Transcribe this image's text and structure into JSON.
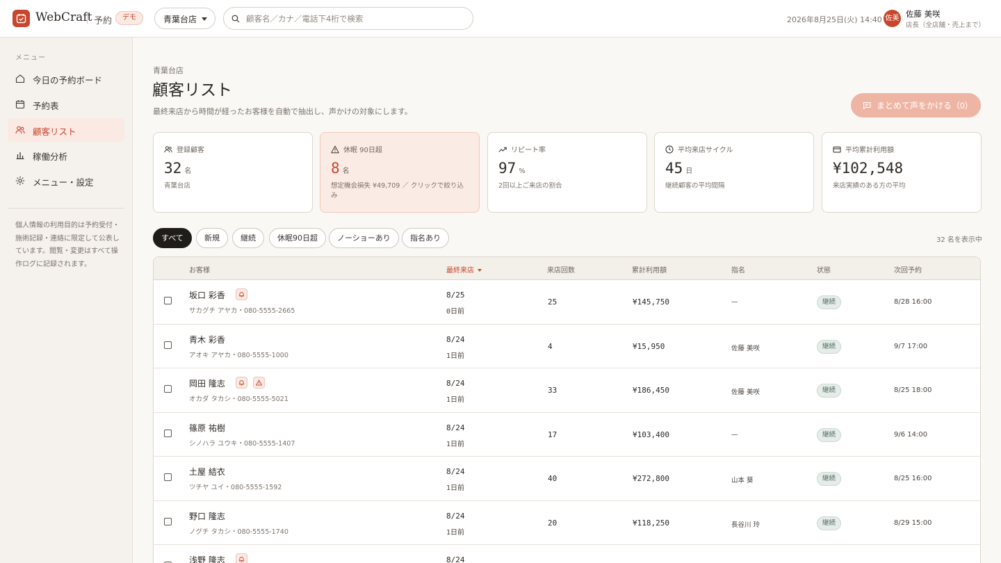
{
  "header": {
    "brand": "WebCraft",
    "brand_sub": "予約",
    "demo_badge": "デモ",
    "store": "青葉台店",
    "search_placeholder": "顧客名／カナ／電話下4桁で検索",
    "datetime": "2026年8月25日(火) 14:40",
    "user_initials": "佐美",
    "user_name": "佐藤 美咲",
    "user_role": "店長（全店舗・売上まで）"
  },
  "sidebar": {
    "heading": "メニュー",
    "items": [
      {
        "label": "今日の予約ボード",
        "icon": "home-icon"
      },
      {
        "label": "予約表",
        "icon": "calendar-icon"
      },
      {
        "label": "顧客リスト",
        "icon": "users-icon",
        "active": true
      },
      {
        "label": "稼働分析",
        "icon": "bar-chart-icon"
      },
      {
        "label": "メニュー・設定",
        "icon": "gear-icon"
      }
    ],
    "note": "個人情報の利用目的は予約受付・施術記録・連絡に限定して公表しています。閲覧・変更はすべて操作ログに記録されます。"
  },
  "main": {
    "breadcrumb": "青葉台店",
    "title": "顧客リスト",
    "description": "最終来店から時間が経ったお客様を自動で抽出し、声かけの対象にします。",
    "bulk_button": "まとめて声をかける（0）",
    "cards": [
      {
        "label": "登録顧客",
        "value": "32",
        "unit": "名",
        "sub": "青葉台店",
        "icon": "users-icon"
      },
      {
        "label": "休眠 90日超",
        "value": "8",
        "unit": "名",
        "sub": "想定機会損失 ¥49,709 ／ クリックで絞り込み",
        "icon": "warning-icon",
        "alert": true
      },
      {
        "label": "リピート率",
        "value": "97",
        "unit": "%",
        "sub": "2回以上ご来店の割合",
        "icon": "trend-up-icon"
      },
      {
        "label": "平均来店サイクル",
        "value": "45",
        "unit": "日",
        "sub": "継続顧客の平均間隔",
        "icon": "clock-icon"
      },
      {
        "label": "平均累計利用額",
        "value": "¥102,548",
        "unit": "",
        "sub": "来店実績のある方の平均",
        "icon": "wallet-icon"
      }
    ],
    "filters": [
      "すべて",
      "新規",
      "継続",
      "休眠90日超",
      "ノーショーあり",
      "指名あり"
    ],
    "active_filter": "すべて",
    "count_note": "32 名を表示中",
    "table": {
      "headers": [
        "お客様",
        "最終来店",
        "来店回数",
        "累計利用額",
        "指名",
        "状態",
        "次回予約"
      ],
      "sorted_by": "最終来店",
      "rows": [
        {
          "name": "坂口 彩香",
          "kana": "サカグチ アヤカ・080-5555-2665",
          "bell": true,
          "warn": false,
          "date": "8/25",
          "ago": "0日前",
          "visits": "25",
          "spend": "¥145,750",
          "staff": "—",
          "status": "継続",
          "next": "8/28 16:00"
        },
        {
          "name": "青木 彩香",
          "kana": "アオキ アヤカ・080-5555-1000",
          "bell": false,
          "warn": false,
          "date": "8/24",
          "ago": "1日前",
          "visits": "4",
          "spend": "¥15,950",
          "staff": "佐藤 美咲",
          "status": "継続",
          "next": "9/7 17:00"
        },
        {
          "name": "岡田 隆志",
          "kana": "オカダ タカシ・080-5555-5021",
          "bell": true,
          "warn": true,
          "date": "8/24",
          "ago": "1日前",
          "visits": "33",
          "spend": "¥186,450",
          "staff": "佐藤 美咲",
          "status": "継続",
          "next": "8/25 18:00"
        },
        {
          "name": "篠原 祐樹",
          "kana": "シノハラ ユウキ・080-5555-1407",
          "bell": false,
          "warn": false,
          "date": "8/24",
          "ago": "1日前",
          "visits": "17",
          "spend": "¥103,400",
          "staff": "—",
          "status": "継続",
          "next": "9/6 14:00"
        },
        {
          "name": "土屋 結衣",
          "kana": "ツチヤ ユイ・080-5555-1592",
          "bell": false,
          "warn": false,
          "date": "8/24",
          "ago": "1日前",
          "visits": "40",
          "spend": "¥272,800",
          "staff": "山本 葵",
          "status": "継続",
          "next": "8/25 16:00"
        },
        {
          "name": "野口 隆志",
          "kana": "ノグチ タカシ・080-5555-1740",
          "bell": false,
          "warn": false,
          "date": "8/24",
          "ago": "1日前",
          "visits": "20",
          "spend": "¥118,250",
          "staff": "長谷川 玲",
          "status": "継続",
          "next": "8/29 15:00"
        },
        {
          "name": "浅野 隆志",
          "kana": "",
          "bell": true,
          "warn": false,
          "date": "8/24",
          "ago": "",
          "visits": "",
          "spend": "",
          "staff": "",
          "status": "",
          "next": ""
        }
      ]
    }
  },
  "colors": {
    "accent": "#c8462c",
    "accent_soft": "#fbe9e3",
    "bg": "#faf8f5"
  }
}
